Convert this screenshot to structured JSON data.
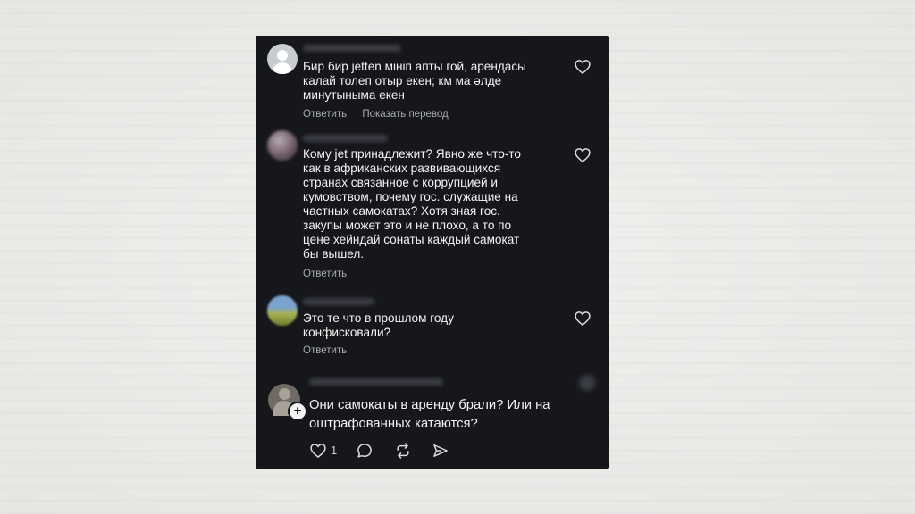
{
  "comments": [
    {
      "text": "Бир бир jetten мініп апты гой, арендасы\nкалай толеп отыр екен; км ма әлде\nминутыныма екен",
      "actions": [
        "Ответить",
        "Показать перевод"
      ]
    },
    {
      "text": "Кому jet принадлежит? Явно же что-то\nкак в африканских развивающихся\nстранах связанное с коррупцией и\nкумовством, почему гос. служащие  на\nчастных самокатах? Хотя зная гос.\nзакупы может это и не плохо, а то по\nцене хейндай сонаты каждый самокат\nбы вышел.",
      "actions": [
        "Ответить"
      ]
    },
    {
      "text": "Это те что в прошлом году\nконфисковали?",
      "actions": [
        "Ответить"
      ]
    }
  ],
  "post": {
    "text": "Они самокаты в аренду брали? Или на оштрафованных катаются?",
    "like_count": "1"
  },
  "icons": {
    "like": "heart-icon",
    "reply": "speech-bubble-icon",
    "repost": "repost-icon",
    "share": "send-icon",
    "add": "plus-icon"
  },
  "colors": {
    "panel_bg": "#16171b",
    "text": "#f4f4f4",
    "muted": "#a9abb2",
    "page_bg": "#ecebe9"
  }
}
